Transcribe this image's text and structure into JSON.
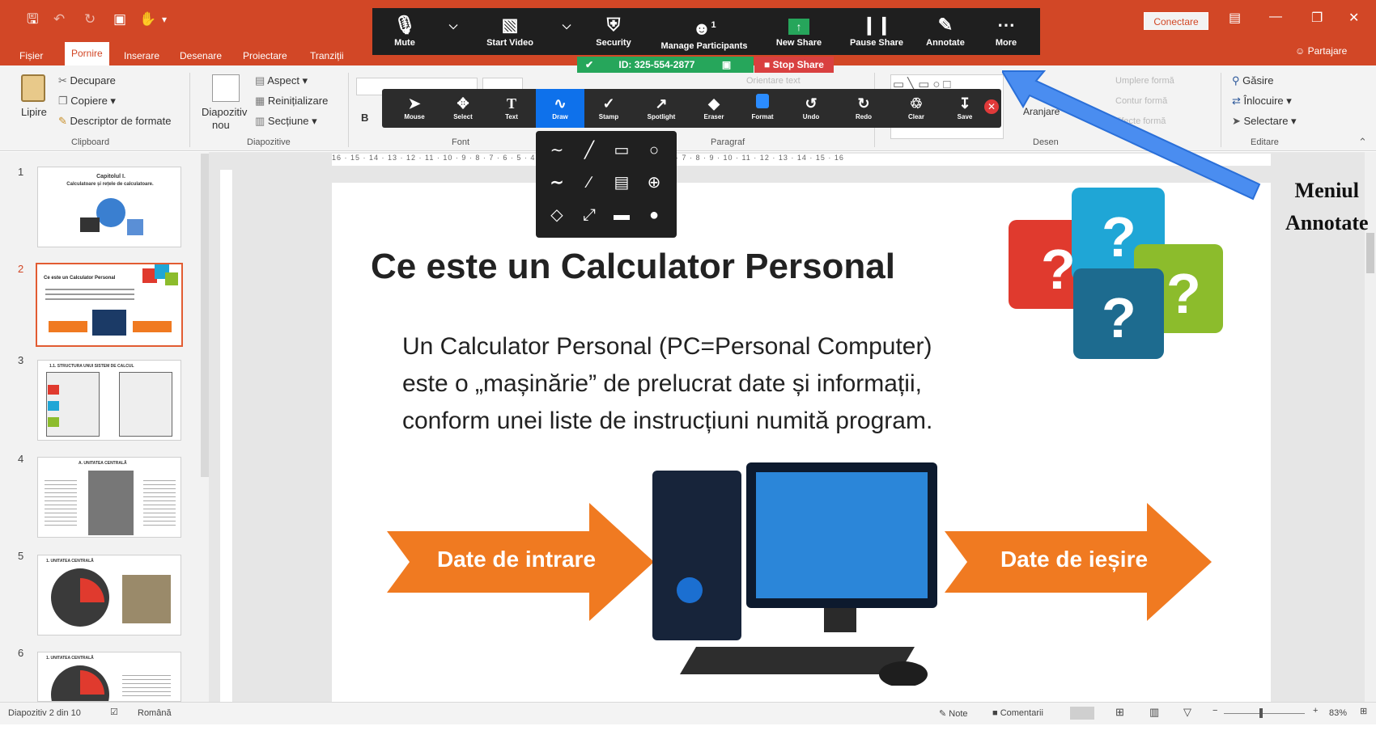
{
  "titlebar": {
    "tabs": [
      "Fișier",
      "Pornire",
      "Inserare",
      "Desenare",
      "Proiectare",
      "Tranziții"
    ],
    "active_tab": "Pornire",
    "connect_button": "Conectare",
    "share_label": "Partajare"
  },
  "ribbon": {
    "clipboard": {
      "paste": "Lipire",
      "cut": "Decupare",
      "copy": "Copiere",
      "format_painter": "Descriptor de formate",
      "group": "Clipboard"
    },
    "slides": {
      "new_slide_1": "Diapozitiv",
      "new_slide_2": "nou",
      "layout": "Aspect",
      "reset": "Reinițializare",
      "section": "Secțiune",
      "group": "Diapozitive"
    },
    "font_group": "Font",
    "paragraph_group": "Paragraf",
    "paragraph_faint": "Orientare text",
    "drawing": {
      "arrange": "Aranjare",
      "shape_fill": "Umplere formă",
      "shape_outline": "Contur formă",
      "shape_effects": "Efecte formă",
      "group": "Desen"
    },
    "editing": {
      "find": "Găsire",
      "replace": "Înlocuire",
      "select": "Selectare",
      "group": "Editare"
    }
  },
  "zoom": {
    "participants_count": "1",
    "buttons": [
      "Mute",
      "Start Video",
      "Security",
      "Manage Participants",
      "New Share",
      "Pause Share",
      "Annotate",
      "More"
    ],
    "meeting_id": "ID: 325-554-2877",
    "stop_share": "Stop Share"
  },
  "annotate": {
    "tools": [
      "Mouse",
      "Select",
      "Text",
      "Draw",
      "Stamp",
      "Spotlight",
      "Eraser",
      "Format",
      "Undo",
      "Redo",
      "Clear",
      "Save"
    ]
  },
  "thumbnails": {
    "numbers": [
      "1",
      "2",
      "3",
      "4",
      "5",
      "6"
    ],
    "slide1_title": "Capitolul I.",
    "slide1_sub": "Calculatoare și rețele de calculatoare.",
    "slide2_title": "Ce este un Calculator Personal",
    "slide3_title": "1.1. STRUCTURA UNUI SISTEM DE CALCUL",
    "slide4_title": "A. UNITATEA CENTRALĂ",
    "slide5_title": "1. UNITATEA CENTRALĂ",
    "slide6_title": "1. UNITATEA CENTRALĂ"
  },
  "ruler": {
    "horizontal": "16 · 15 · 14 · 13 · 12 · 11 · 10 · 9 · 8 · 7 · 6 · 5 · 4 · 3 · 2 · 1 · 0 · 1 · 2 · 3 · 4 · 5 · 6 · 7 · 8 · 9 · 10 · 11 · 12 · 13 · 14 · 15 · 16"
  },
  "slide": {
    "title": "Ce este un Calculator Personal",
    "line1": "Un Calculator Personal (PC=Personal Computer)",
    "line2": "este o „mașinărie” de prelucrat date și informații,",
    "line3": "conform unei liste de instrucțiuni numită program.",
    "input_label": "Date de intrare",
    "output_label": "Date de ieșire"
  },
  "annotation_callout": {
    "line1": "Meniul",
    "line2": "Annotate"
  },
  "statusbar": {
    "slide_info": "Diapozitiv 2 din 10",
    "language": "Română",
    "notes": "Note",
    "comments": "Comentarii",
    "zoom": "83%"
  },
  "colors": {
    "accent": "#d24726",
    "zoom_bar": "#1f1f1f",
    "meeting_green": "#26a65b",
    "stop_red": "#d94040",
    "pointer_arrow": "#4a8df0",
    "orange_arrow": "#f07a21"
  }
}
